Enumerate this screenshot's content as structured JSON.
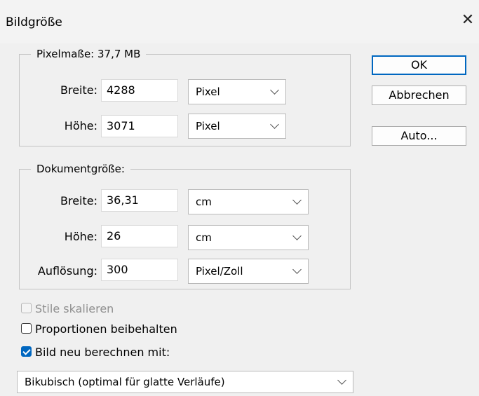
{
  "window": {
    "title": "Bildgröße",
    "close_glyph": "✕"
  },
  "pixel_dimensions": {
    "legend": "Pixelmaße: 37,7 MB",
    "width_label": "Breite:",
    "width_value": "4288",
    "width_unit": "Pixel",
    "height_label": "Höhe:",
    "height_value": "3071",
    "height_unit": "Pixel"
  },
  "document_size": {
    "legend": "Dokumentgröße:",
    "width_label": "Breite:",
    "width_value": "36,31",
    "width_unit": "cm",
    "height_label": "Höhe:",
    "height_value": "26",
    "height_unit": "cm",
    "resolution_label": "Auflösung:",
    "resolution_value": "300",
    "resolution_unit": "Pixel/Zoll"
  },
  "buttons": {
    "ok": "OK",
    "cancel": "Abbrechen",
    "auto": "Auto..."
  },
  "options": {
    "scale_styles": {
      "label": "Stile skalieren",
      "checked": false,
      "enabled": false
    },
    "constrain_proportions": {
      "label": "Proportionen beibehalten",
      "checked": false,
      "enabled": true
    },
    "resample": {
      "label": "Bild neu berechnen mit:",
      "checked": true,
      "enabled": true
    }
  },
  "resample_method": {
    "value": "Bikubisch (optimal für glatte Verläufe)"
  }
}
